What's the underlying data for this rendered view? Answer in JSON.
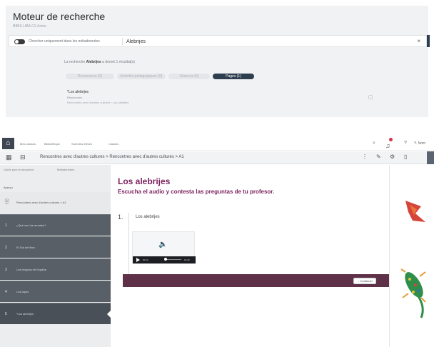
{
  "search_engine": {
    "title": "Moteur de recherche",
    "subtitle": "BIBIS LIBA CX Acine",
    "toggle_label": "Chercher uniquement dans les métadonnées",
    "query": "Alebrijes",
    "close": "×",
    "result_prefix": "La recherche",
    "result_term": "Alebrijes",
    "result_suffix": "a donné 1 résultat(s)",
    "filters": [
      "Ressources (0)",
      "Activités pédagogiques (0)",
      "Séances (0)",
      "Pages (1)"
    ],
    "result": {
      "title": "*Los alebrijes",
      "type": "Ressources",
      "path": "Rencontres avec d'autres cultures › Los alebrijes"
    }
  },
  "viewer": {
    "nav": {
      "links": [
        "Mes classes",
        "Bibliothèque",
        "Suivi des élèves",
        "Classes"
      ],
      "help": "?",
      "user": "Y. Nom"
    },
    "breadcrumb": "Rencontres avec d'autres cultures > Rencontres avec d'autres cultures > A1",
    "sidebar": {
      "tabs": [
        "Guide pour le séquence",
        "Métadonnées"
      ],
      "apercu_label": "Aperçu",
      "items": [
        {
          "num": "",
          "label": "Rencontres avec d'autres cultures > A1"
        },
        {
          "num": "1",
          "label": "¿Qué son los murales?"
        },
        {
          "num": "2",
          "label": "El Día del libro"
        },
        {
          "num": "3",
          "label": "Las lenguas de España"
        },
        {
          "num": "4",
          "label": "Las tapas"
        },
        {
          "num": "5",
          "label": "*Los alebrijes"
        }
      ]
    },
    "lesson": {
      "title": "Los alebrijes",
      "instruction": "Escucha el audio y contesta las preguntas de tu profesor.",
      "question_number": "1.",
      "question_label": "Los alebrijes",
      "audio": {
        "current_time": "00:13",
        "duration": "01:29",
        "progress_fraction": 0.1
      },
      "continue_label": "→ Continuer"
    }
  }
}
